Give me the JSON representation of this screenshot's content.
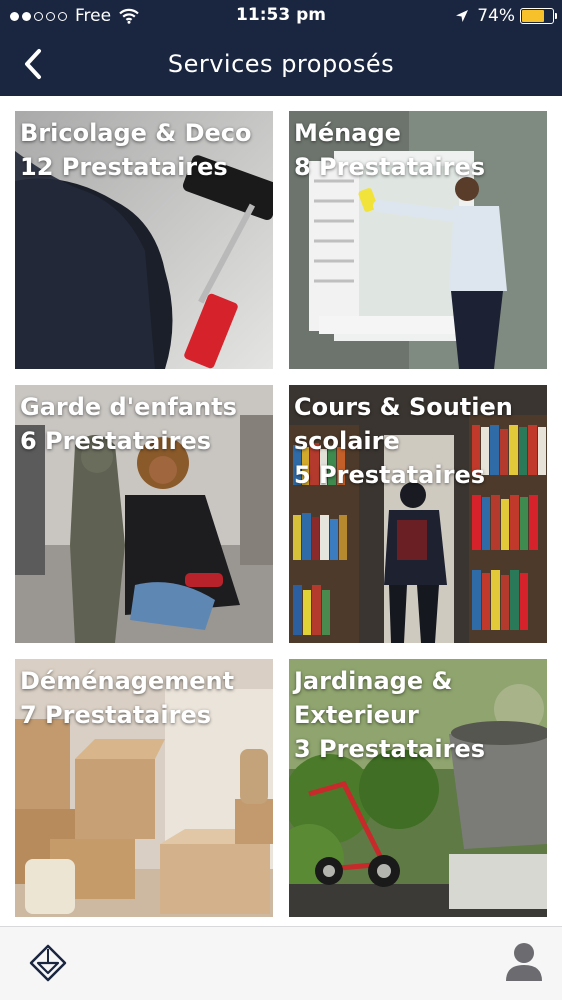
{
  "status_bar": {
    "carrier": "Free",
    "time": "11:53 pm",
    "battery_percent": "74%",
    "battery_level": 0.74,
    "signal_bars_filled": 2,
    "signal_bars_total": 5,
    "battery_color": "#f6c12a"
  },
  "nav_bar": {
    "title": "Services proposés",
    "back_icon": "chevron-left-icon",
    "background": "#1a2640"
  },
  "services": [
    {
      "title": "Bricolage & Deco",
      "providers": "12 Prestataires"
    },
    {
      "title": "Ménage",
      "providers": "8 Prestataires"
    },
    {
      "title": "Garde d'enfants",
      "providers": "6 Prestataires"
    },
    {
      "title": "Cours & Soutien scolaire",
      "providers": "5 Prestataires"
    },
    {
      "title": "Déménagement",
      "providers": "7 Prestataires"
    },
    {
      "title": "Jardinage & Exterieur",
      "providers": "3 Prestataires"
    }
  ],
  "tab_bar": {
    "home_icon": "diamond-logo-icon",
    "profile_icon": "user-icon"
  }
}
